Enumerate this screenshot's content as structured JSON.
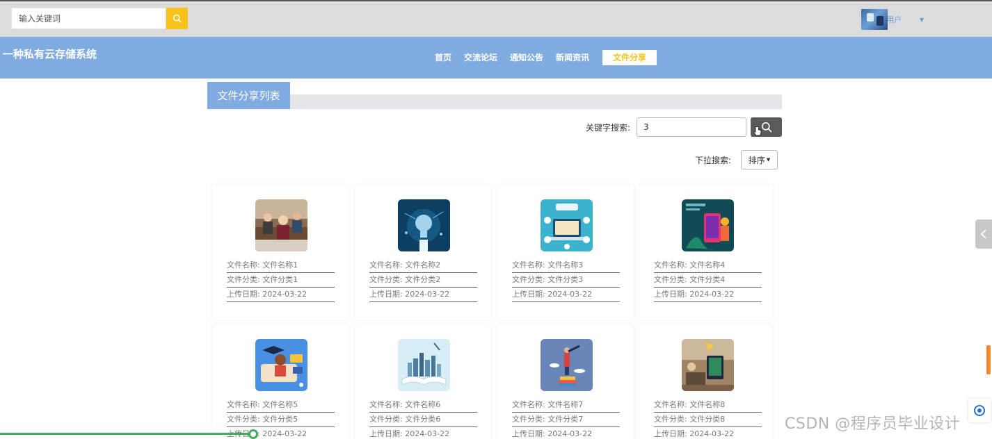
{
  "header": {
    "search_placeholder": "输入关键词",
    "user_label": "用户"
  },
  "nav": {
    "site_title": "一种私有云存储系统",
    "items": [
      "首页",
      "交流论坛",
      "通知公告",
      "新闻资讯",
      "文件分享"
    ],
    "active_index": 4
  },
  "list": {
    "tab_title": "文件分享列表",
    "keyword_label": "关键字搜索:",
    "keyword_value": "3",
    "dropdown_label": "下拉搜索:",
    "sort_label": "排序"
  },
  "field_labels": {
    "name": "文件名称:",
    "category": "文件分类:",
    "date": "上传日期:"
  },
  "cards": [
    {
      "name": "文件名称1",
      "category": "文件分类1",
      "date": "2024-03-22",
      "image": "classroom-students-photo"
    },
    {
      "name": "文件名称2",
      "category": "文件分类2",
      "date": "2024-03-22",
      "image": "tech-lightbulb-illustration"
    },
    {
      "name": "文件名称3",
      "category": "文件分类3",
      "date": "2024-03-22",
      "image": "online-education-illustration"
    },
    {
      "name": "文件名称4",
      "category": "文件分类4",
      "date": "2024-03-22",
      "image": "mobile-learning-illustration"
    },
    {
      "name": "文件名称5",
      "category": "文件分类5",
      "date": "2024-03-22",
      "image": "graduate-study-illustration"
    },
    {
      "name": "文件名称6",
      "category": "文件分类6",
      "date": "2024-03-22",
      "image": "open-book-city-illustration"
    },
    {
      "name": "文件名称7",
      "category": "文件分类7",
      "date": "2024-03-22",
      "image": "telescope-books-illustration"
    },
    {
      "name": "文件名称8",
      "category": "文件分类8",
      "date": "2024-03-22",
      "image": "study-desk-photo"
    }
  ],
  "watermark": "CSDN @程序员毕业设计",
  "colors": {
    "accent": "#f7c31b",
    "nav_bg": "#7fabe0",
    "topbar_bg": "#dcdcdc"
  }
}
